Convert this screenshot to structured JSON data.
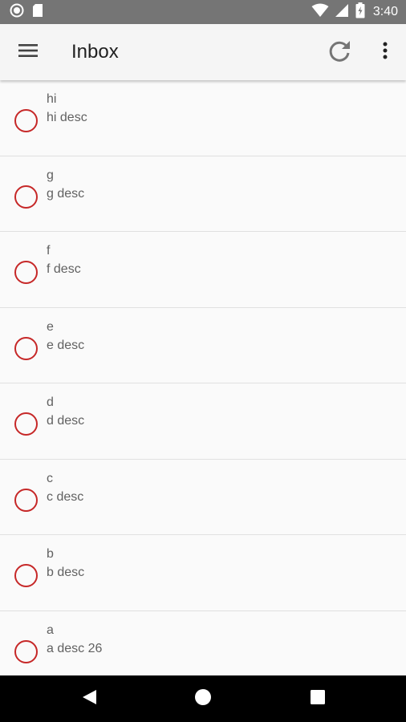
{
  "status_bar": {
    "time": "3:40",
    "icons": [
      "circle-notification-icon",
      "sd-card-icon",
      "wifi-icon",
      "cell-signal-icon",
      "battery-charging-icon"
    ]
  },
  "app_bar": {
    "title": "Inbox",
    "menu_icon": "hamburger-menu-icon",
    "refresh_icon": "refresh-icon",
    "more_icon": "more-vertical-icon"
  },
  "colors": {
    "status_bar_bg": "#757575",
    "app_bar_bg": "#f5f5f5",
    "task_circle": "#c62828",
    "text_secondary": "#616161"
  },
  "tasks": [
    {
      "title": "hi",
      "description": "hi desc"
    },
    {
      "title": "g",
      "description": "g desc"
    },
    {
      "title": "f",
      "description": "f desc"
    },
    {
      "title": "e",
      "description": "e desc"
    },
    {
      "title": "d",
      "description": "d desc"
    },
    {
      "title": "c",
      "description": "c desc"
    },
    {
      "title": "b",
      "description": "b desc"
    },
    {
      "title": "a",
      "description": "a desc 26"
    }
  ],
  "nav_bar": {
    "buttons": [
      "back-icon",
      "home-icon",
      "recents-icon"
    ]
  }
}
